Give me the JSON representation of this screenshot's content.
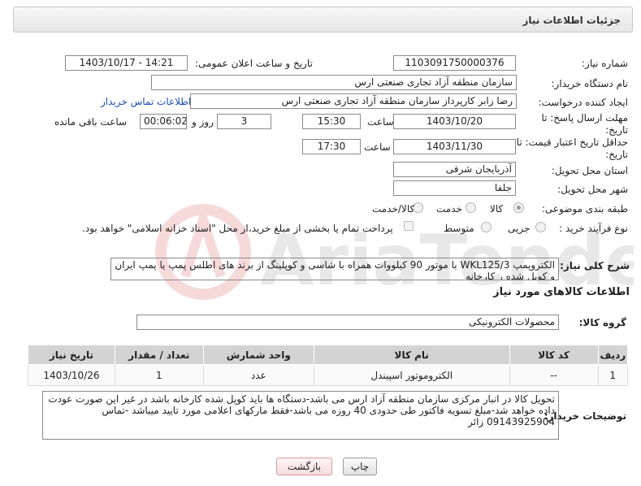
{
  "panel": {
    "title": "جزئیات اطلاعات نیاز"
  },
  "fields": {
    "need_number_label": "شماره نیاز:",
    "need_number": "1103091750000376",
    "announce_label": "تاریخ و ساعت اعلان عمومی:",
    "announce_value": "1403/10/17 - 14:21",
    "buyer_org_label": "نام دستگاه خریدار:",
    "buyer_org": "سازمان منطقه آزاد تجاری صنعتی ارس",
    "creator_label": "ایجاد کننده درخواست:",
    "creator": "رضا زابر کارپرداز سازمان منطقه آزاد تجاری صنعتی ارس",
    "contact_link": "اطلاعات تماس خریدار",
    "deadline_label": "مهلت ارسال پاسخ: تا تاریخ:",
    "deadline_date": "1403/10/20",
    "time_label": "ساعت",
    "deadline_time": "15:30",
    "days_value": "3",
    "days_label": "روز و",
    "remaining_time": "00:06:02",
    "remaining_label": "ساعت باقی مانده",
    "validity_label": "حداقل تاریخ اعتبار قیمت: تا تاریخ:",
    "validity_date": "1403/11/30",
    "validity_time_label": "ساعت",
    "validity_time": "17:30",
    "province_label": "استان محل تحویل:",
    "province": "آذربایجان شرقی",
    "city_label": "شهر محل تحویل:",
    "city": "جلفا",
    "category_label": "طبقه بندی موضوعی:",
    "category_options": [
      "کالا",
      "خدمت",
      "کالا/خدمت"
    ],
    "category_selected": "کالا",
    "process_label": "نوع فرآیند خرید :",
    "process_options": [
      "جزیی",
      "متوسط"
    ],
    "process_note": "پرداخت تمام یا بخشی از مبلغ خرید،از محل \"اسناد خزانه اسلامی\" خواهد بود."
  },
  "description": {
    "label": "شرح کلی نیاز:",
    "text": "الکتروپمپ WKL125/3 با موتور 90 کیلووات همراه با شاسی و کوپلینگ از برند های اطلس پمپ یا پمپ ایران و کوپل شده ر کارخانه"
  },
  "goods_info_title": "اطلاعات کالاهای مورد نیاز",
  "goods_group": {
    "label": "گروه کالا:",
    "value": "محصولات الکترونیکی"
  },
  "table": {
    "headers": [
      "ردیف",
      "کد کالا",
      "نام کالا",
      "واحد شمارش",
      "تعداد / مقدار",
      "تاریخ نیاز"
    ],
    "rows": [
      [
        "1",
        "--",
        "الکتروموتور اسپیندل",
        "عدد",
        "1",
        "1403/10/26"
      ]
    ]
  },
  "buyer_notes": {
    "label": "توضیحات خریدار:",
    "text": "تحویل کالا در انبار مرکزی سازمان منطقه آزاد ارس می باشد-دستگاه ها باید کوپل شده کارخانه باشد در غیر این صورت عودت داده خواهد شد-مبلغ تسویه فاکتور طی حدودی 40 روزه می باشد-فقط مارکهای اعلامی مورد تایید میباشد -تماس 09143925904 زائر"
  },
  "buttons": {
    "print": "چاپ",
    "back": "بازگشت"
  },
  "watermark": {
    "text": "AriaTender.neT"
  }
}
